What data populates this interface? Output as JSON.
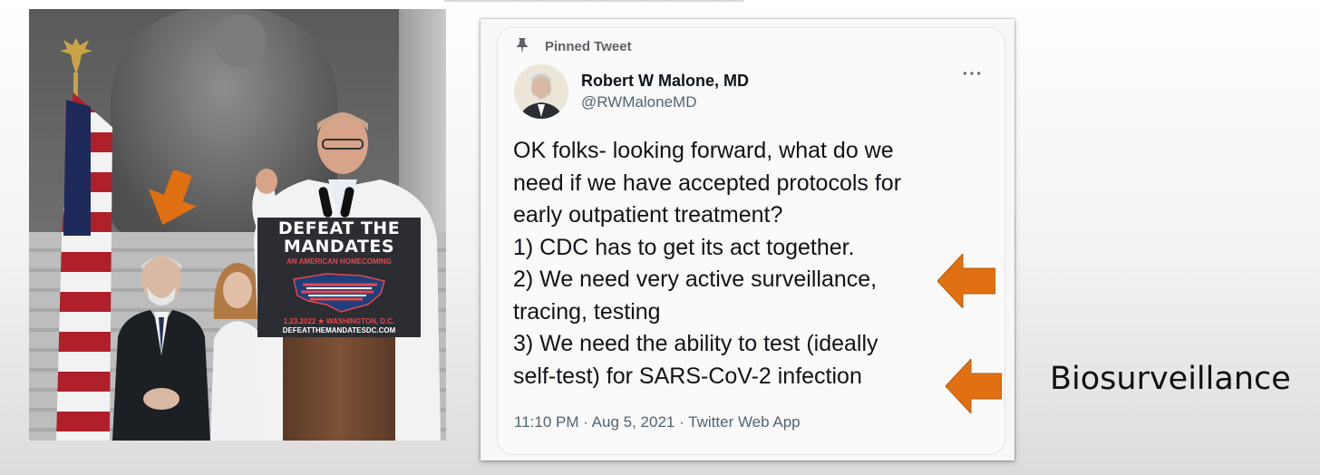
{
  "colors": {
    "arrow": "#e07012",
    "card_bg": "#f7f7f7",
    "text_dark": "#0f1419",
    "text_muted": "#536471"
  },
  "photo": {
    "sign": {
      "line1": "DEFEAT THE",
      "line2": "MANDATES",
      "line3": "AN AMERICAN HOMECOMING",
      "date": "1.23.2022 ★ WASHINGTON, D.C.",
      "url": "DEFEATTHEMANDATESDC.COM"
    }
  },
  "tweet": {
    "pinned_label": "Pinned Tweet",
    "pinned_icon": "pin-icon",
    "author_name": "Robert W Malone, MD",
    "author_handle": "@RWMaloneMD",
    "more_icon": "more-horizontal-icon",
    "lines": [
      "OK folks- looking forward, what do we",
      "need if we have accepted protocols for",
      "early outpatient treatment?",
      "1) CDC has to get its act together.",
      "2) We need very active surveillance,",
      "tracing, testing",
      "3) We need the ability to test (ideally",
      "self-test) for SARS-CoV-2 infection"
    ],
    "meta": "11:10 PM · Aug 5, 2021 · Twitter Web App"
  },
  "side_label": "Biosurveillance"
}
